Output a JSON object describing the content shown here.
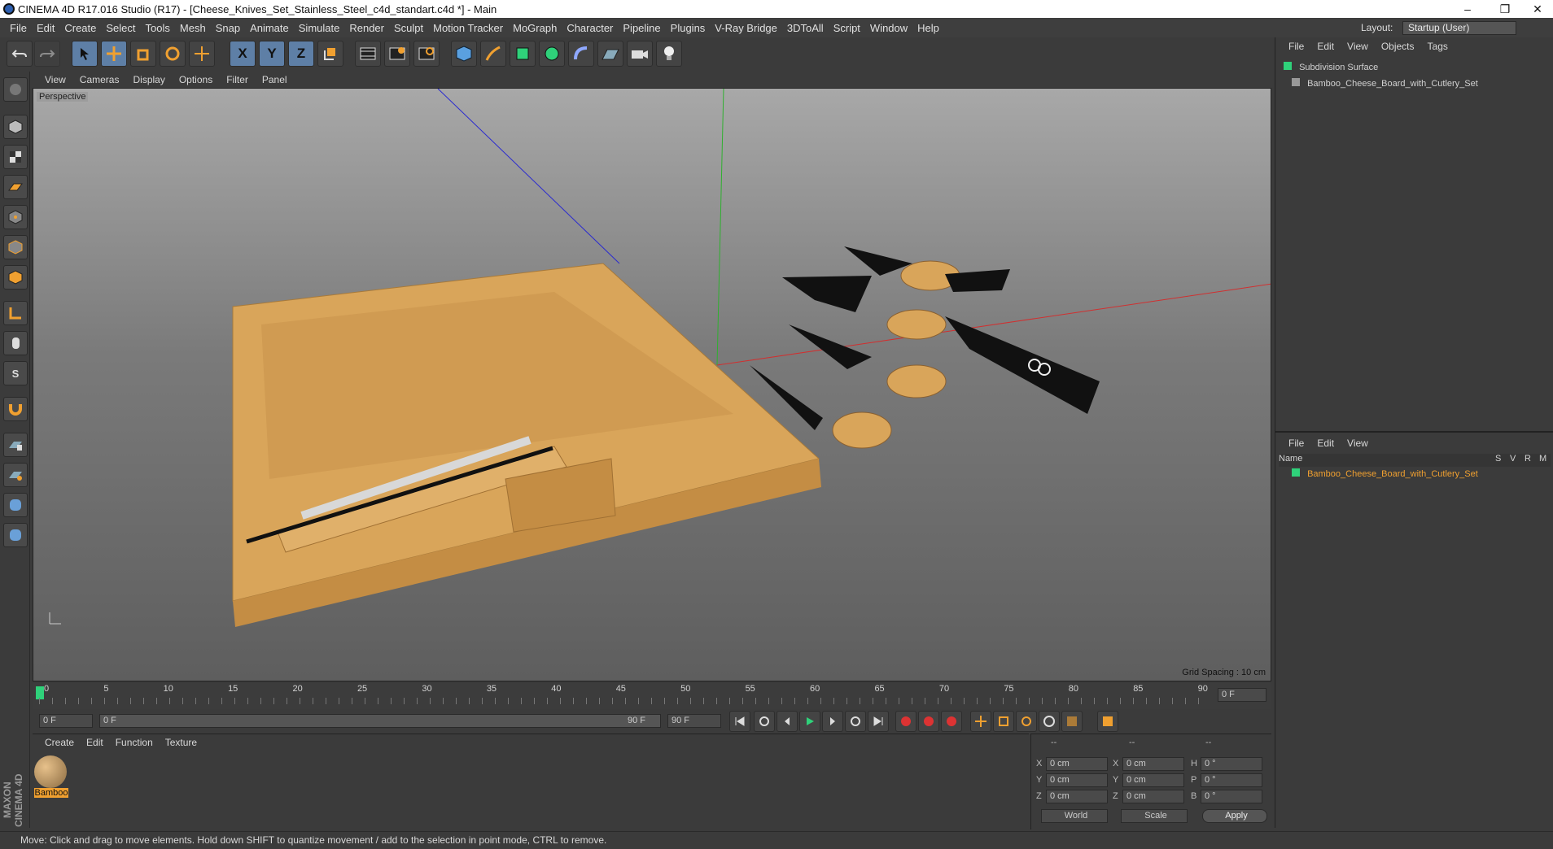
{
  "window": {
    "title": "CINEMA 4D R17.016 Studio (R17) - [Cheese_Knives_Set_Stainless_Steel_c4d_standart.c4d *] - Main",
    "minimize": "–",
    "restore": "❐",
    "close": "✕"
  },
  "menubar": {
    "items": [
      "File",
      "Edit",
      "Create",
      "Select",
      "Tools",
      "Mesh",
      "Snap",
      "Animate",
      "Simulate",
      "Render",
      "Sculpt",
      "Motion Tracker",
      "MoGraph",
      "Character",
      "Pipeline",
      "Plugins",
      "V-Ray Bridge",
      "3DToAll",
      "Script",
      "Window",
      "Help"
    ],
    "layout_label": "Layout:",
    "layout_value": "Startup (User)"
  },
  "toolbar": {
    "icons": [
      "undo-icon",
      "redo-icon",
      "select-arrow-icon",
      "move-icon",
      "scale-icon",
      "rotate-icon",
      "move-cross-icon",
      "x-axis-icon",
      "y-axis-icon",
      "z-axis-icon",
      "coordinate-system-icon",
      "render-view-icon",
      "render-region-icon",
      "render-settings-icon",
      "cube-icon",
      "pen-icon",
      "subdivision-icon",
      "cloner-icon",
      "deformer-icon",
      "floor-icon",
      "camera-icon",
      "light-icon"
    ],
    "axis_labels": [
      "X",
      "Y",
      "Z"
    ]
  },
  "viewport": {
    "menu": [
      "View",
      "Cameras",
      "Display",
      "Options",
      "Filter",
      "Panel"
    ],
    "label": "Perspective",
    "grid_spacing": "Grid Spacing : 10 cm"
  },
  "timeline": {
    "ticks": [
      "0",
      "5",
      "10",
      "15",
      "20",
      "25",
      "30",
      "35",
      "40",
      "45",
      "50",
      "55",
      "60",
      "65",
      "70",
      "75",
      "80",
      "85",
      "90"
    ],
    "end_frame": "0 F",
    "start_field": "0 F",
    "range_left": "0 F",
    "range_right": "90 F",
    "end_field": "90 F"
  },
  "material_panel": {
    "menu": [
      "Create",
      "Edit",
      "Function",
      "Texture"
    ],
    "material_name": "Bamboo"
  },
  "coords": {
    "rows": [
      {
        "a": "X",
        "av": "0 cm",
        "b": "X",
        "bv": "0 cm",
        "c": "H",
        "cv": "0 °"
      },
      {
        "a": "Y",
        "av": "0 cm",
        "b": "Y",
        "bv": "0 cm",
        "c": "P",
        "cv": "0 °"
      },
      {
        "a": "Z",
        "av": "0 cm",
        "b": "Z",
        "bv": "0 cm",
        "c": "B",
        "cv": "0 °"
      }
    ],
    "world": "World",
    "scale": "Scale",
    "apply": "Apply",
    "headers": [
      "--",
      "--",
      "--"
    ]
  },
  "object_manager": {
    "menu": [
      "File",
      "Edit",
      "View",
      "Objects",
      "Tags"
    ],
    "objects": [
      {
        "name": "Subdivision Surface"
      },
      {
        "name": "Bamboo_Cheese_Board_with_Cutlery_Set"
      }
    ]
  },
  "attr_manager": {
    "menu": [
      "File",
      "Edit",
      "View"
    ],
    "columns": [
      "Name",
      "S",
      "V",
      "R",
      "M"
    ],
    "row": "Bamboo_Cheese_Board_with_Cutlery_Set"
  },
  "status": "Move: Click and drag to move elements. Hold down SHIFT to quantize movement / add to the selection in point mode, CTRL to remove.",
  "brand": "MAXON CINEMA 4D",
  "colors": {
    "accent": "#f0a030",
    "selection": "#5e7fa6",
    "green": "#2fd17a"
  }
}
